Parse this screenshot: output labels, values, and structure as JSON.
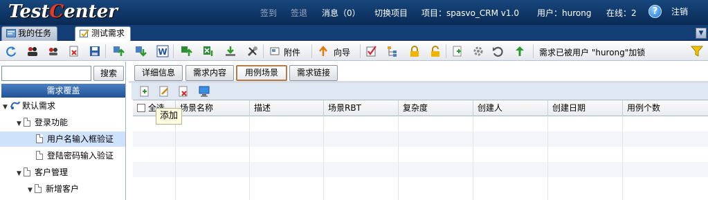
{
  "header": {
    "logo_prefix": "Test",
    "logo_c": "C",
    "logo_suffix": "enter",
    "sign_in": "签到",
    "sign_out_short": "签退",
    "messages": "消息（0）",
    "switch_project": "切换项目",
    "project": "项目：spasvo_CRM v1.0",
    "user": "用户：hurong",
    "online": "在线：2",
    "help": "?",
    "logout": "注销"
  },
  "tabs": [
    {
      "label": "我的任务",
      "active": false
    },
    {
      "label": "测试需求",
      "active": true
    }
  ],
  "tab_menu_icon": "chevron-down-icon",
  "toolbar": {
    "attachment": "附件",
    "wizard": "向导",
    "lock_status": "需求已被用户 \"hurong\"加锁"
  },
  "left": {
    "search_placeholder": "",
    "search_button": "搜索",
    "panel_title": "需求覆盖",
    "tree": [
      {
        "label": "默认需求"
      },
      {
        "label": "登录功能"
      },
      {
        "label": "用户名输入框验证",
        "selected": true
      },
      {
        "label": "登陆密码输入验证"
      },
      {
        "label": "客户管理"
      },
      {
        "label": "新增客户"
      }
    ]
  },
  "subtabs": [
    {
      "label": "详细信息",
      "active": false
    },
    {
      "label": "需求内容",
      "active": false
    },
    {
      "label": "用例场景",
      "active": true
    },
    {
      "label": "需求链接",
      "active": false
    }
  ],
  "grid": {
    "columns": [
      "全选",
      "场景名称",
      "描述",
      "场景RBT",
      "复杂度",
      "创建人",
      "创建日期",
      "用例个数"
    ],
    "rows": []
  },
  "tooltip": "添加",
  "colors": {
    "header_bg": "#0a2a55",
    "accent_blue": "#1f5199",
    "selected_row": "#cfe2fb",
    "active_subtab_border": "#b57a45"
  }
}
